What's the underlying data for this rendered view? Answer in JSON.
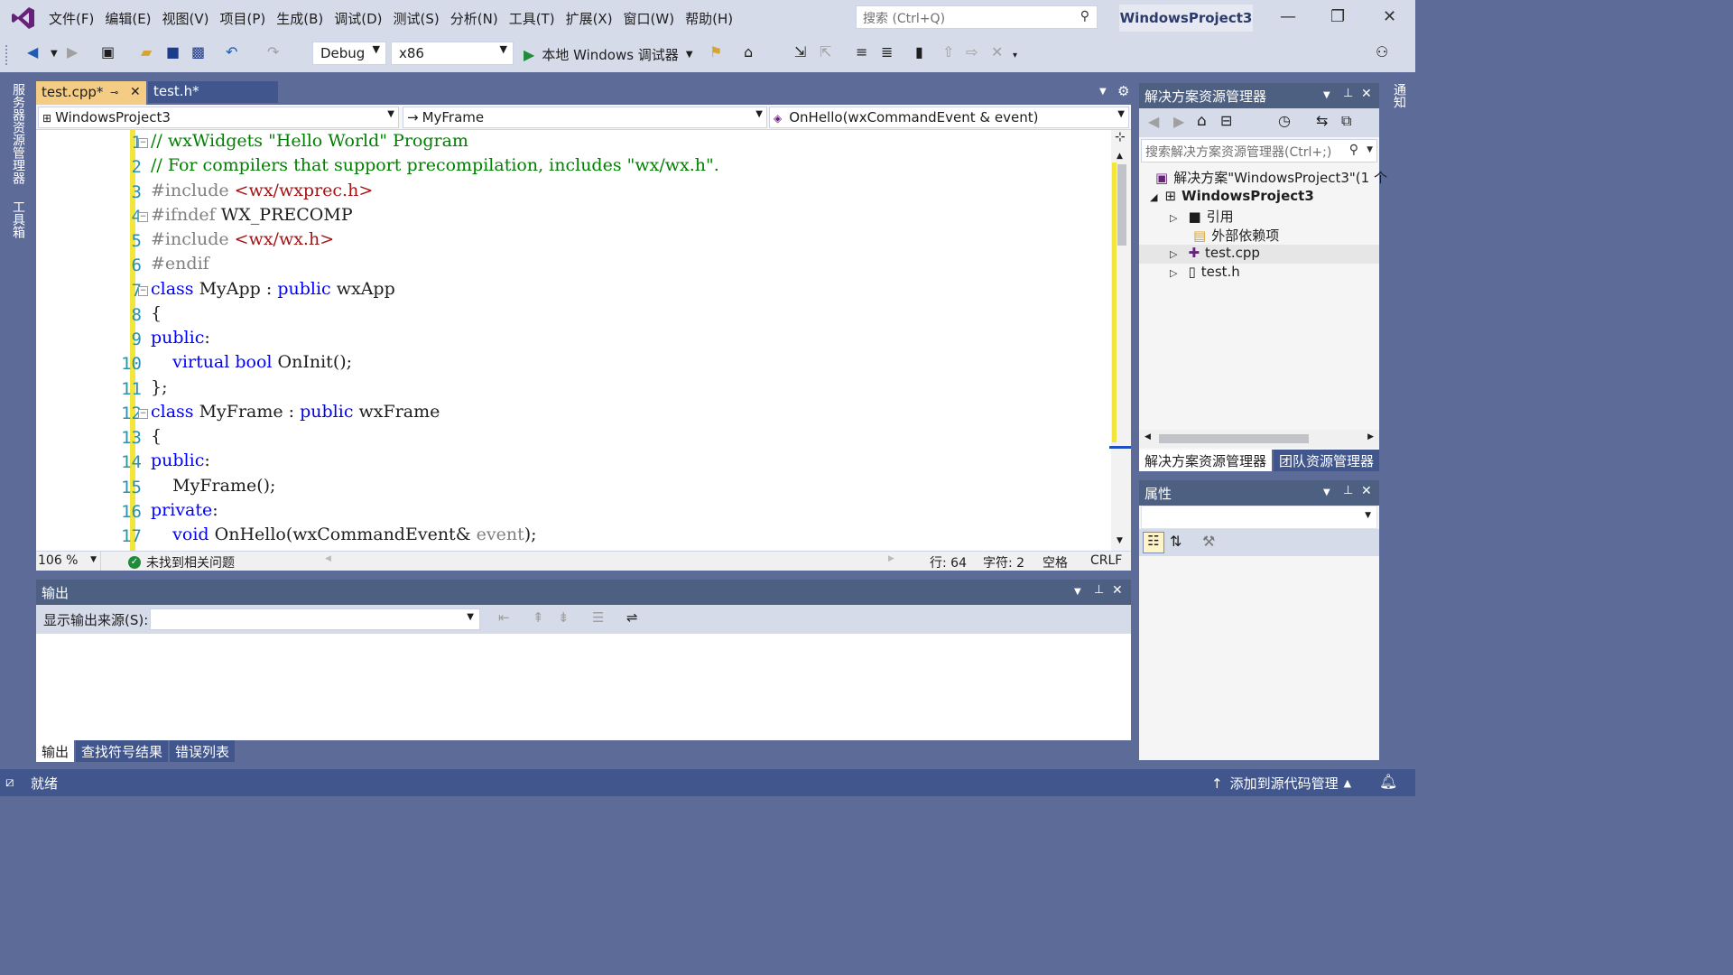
{
  "menu": {
    "items": [
      "文件(F)",
      "编辑(E)",
      "视图(V)",
      "项目(P)",
      "生成(B)",
      "调试(D)",
      "测试(S)",
      "分析(N)",
      "工具(T)",
      "扩展(X)",
      "窗口(W)",
      "帮助(H)"
    ]
  },
  "search": {
    "placeholder": "搜索 (Ctrl+Q)"
  },
  "window": {
    "project_name": "WindowsProject3",
    "minimize": "—",
    "restore": "❐",
    "close": "✕"
  },
  "toolbar": {
    "config": "Debug",
    "platform": "x86",
    "run_label": "本地 Windows 调试器"
  },
  "left_tabs": {
    "server_explorer": "服务器资源管理器",
    "toolbox": "工具箱"
  },
  "right_tabs": {
    "notifications": "通知"
  },
  "editor": {
    "tabs": [
      {
        "label": "test.cpp*",
        "active": true
      },
      {
        "label": "test.h*",
        "active": false
      }
    ],
    "nav": {
      "project": "WindowsProject3",
      "class": "MyFrame",
      "member": "OnHello(wxCommandEvent & event)"
    },
    "lines": [
      {
        "n": "1",
        "fold": "⊟",
        "tokens": [
          {
            "t": "c",
            "v": "// wxWidgets \"Hello World\" Program"
          }
        ]
      },
      {
        "n": "2",
        "fold": "",
        "tokens": [
          {
            "t": "c",
            "v": "// For compilers that support precompilation, includes \"wx/wx.h\"."
          }
        ]
      },
      {
        "n": "3",
        "fold": "",
        "tokens": [
          {
            "t": "p",
            "v": "#include "
          },
          {
            "t": "s",
            "v": "<wx/wxprec.h>"
          }
        ]
      },
      {
        "n": "4",
        "fold": "⊟",
        "tokens": [
          {
            "t": "p",
            "v": "#ifndef "
          },
          {
            "t": "",
            "v": "WX_PRECOMP"
          }
        ]
      },
      {
        "n": "5",
        "fold": "",
        "tokens": [
          {
            "t": "p",
            "v": "#include "
          },
          {
            "t": "s",
            "v": "<wx/wx.h>"
          }
        ]
      },
      {
        "n": "6",
        "fold": "",
        "tokens": [
          {
            "t": "p",
            "v": "#endif"
          }
        ]
      },
      {
        "n": "7",
        "fold": "⊟",
        "tokens": [
          {
            "t": "k",
            "v": "class "
          },
          {
            "t": "",
            "v": "MyApp : "
          },
          {
            "t": "k",
            "v": "public "
          },
          {
            "t": "",
            "v": "wxApp"
          }
        ]
      },
      {
        "n": "8",
        "fold": "",
        "tokens": [
          {
            "t": "",
            "v": "{"
          }
        ]
      },
      {
        "n": "9",
        "fold": "",
        "tokens": [
          {
            "t": "k",
            "v": "public"
          },
          {
            "t": "",
            "v": ":"
          }
        ]
      },
      {
        "n": "10",
        "fold": "",
        "tokens": [
          {
            "t": "",
            "v": "    "
          },
          {
            "t": "k",
            "v": "virtual bool "
          },
          {
            "t": "",
            "v": "OnInit();"
          }
        ]
      },
      {
        "n": "11",
        "fold": "",
        "tokens": [
          {
            "t": "",
            "v": "};"
          }
        ]
      },
      {
        "n": "12",
        "fold": "⊟",
        "tokens": [
          {
            "t": "k",
            "v": "class "
          },
          {
            "t": "",
            "v": "MyFrame : "
          },
          {
            "t": "k",
            "v": "public "
          },
          {
            "t": "",
            "v": "wxFrame"
          }
        ]
      },
      {
        "n": "13",
        "fold": "",
        "tokens": [
          {
            "t": "",
            "v": "{"
          }
        ]
      },
      {
        "n": "14",
        "fold": "",
        "tokens": [
          {
            "t": "k",
            "v": "public"
          },
          {
            "t": "",
            "v": ":"
          }
        ]
      },
      {
        "n": "15",
        "fold": "",
        "tokens": [
          {
            "t": "",
            "v": "    MyFrame();"
          }
        ]
      },
      {
        "n": "16",
        "fold": "",
        "tokens": [
          {
            "t": "k",
            "v": "private"
          },
          {
            "t": "",
            "v": ":"
          }
        ]
      },
      {
        "n": "17",
        "fold": "",
        "tokens": [
          {
            "t": "",
            "v": "    "
          },
          {
            "t": "k",
            "v": "void "
          },
          {
            "t": "",
            "v": "OnHello(wxCommandEvent& "
          },
          {
            "t": "v",
            "v": "event"
          },
          {
            "t": "",
            "v": ");"
          }
        ]
      }
    ],
    "zoom": "106 %",
    "issues": "未找到相关问题",
    "line_info": "行: 64",
    "char_info": "字符: 2",
    "indent": "空格",
    "eol": "CRLF"
  },
  "output": {
    "title": "输出",
    "source_label": "显示输出来源(S):",
    "tabs": [
      "输出",
      "查找符号结果",
      "错误列表"
    ]
  },
  "solution_explorer": {
    "title": "解决方案资源管理器",
    "search_placeholder": "搜索解决方案资源管理器(Ctrl+;)",
    "tree": {
      "solution": "解决方案\"WindowsProject3\"(1 个",
      "project": "WindowsProject3",
      "references": "引用",
      "external_deps": "外部依赖项",
      "file_cpp": "test.cpp",
      "file_h": "test.h"
    },
    "tabs": [
      "解决方案资源管理器",
      "团队资源管理器"
    ]
  },
  "properties": {
    "title": "属性"
  },
  "statusbar": {
    "ready": "就绪",
    "source_control": "添加到源代码管理"
  },
  "colors": {
    "frame": "#5d6b99",
    "active_tab": "#f5cc84",
    "panel_header": "#4d6082",
    "keyword": "#0000ff",
    "comment": "#008000",
    "string": "#a31515"
  }
}
